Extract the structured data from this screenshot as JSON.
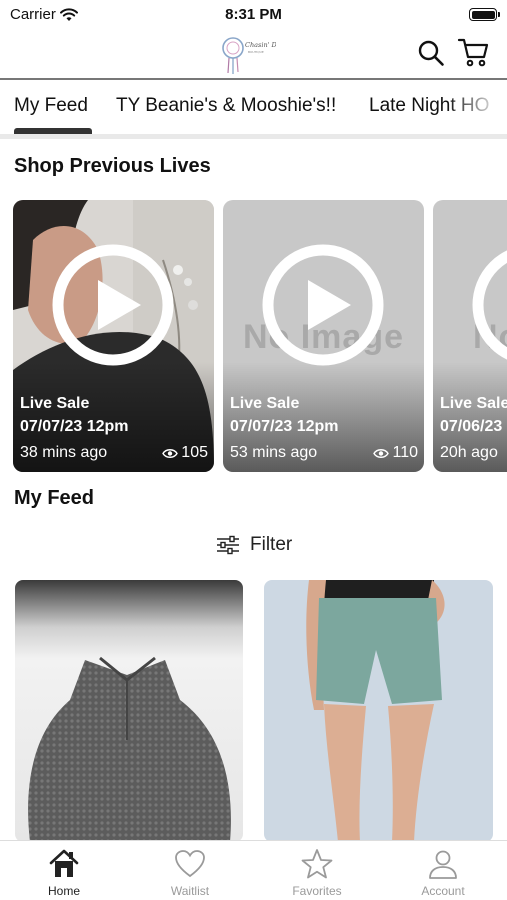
{
  "status_bar": {
    "carrier": "Carrier",
    "time": "8:31 PM"
  },
  "header": {
    "logo_text": "Chasin' Dreams",
    "logo_subtext": "BOUTIQUE"
  },
  "tabs": [
    {
      "label": "My Feed",
      "active": true
    },
    {
      "label": "TY Beanie's & Mooshie's!!",
      "active": false
    },
    {
      "label": "Late Night HO",
      "active": false
    }
  ],
  "previous_lives": {
    "title": "Shop Previous Lives",
    "cards": [
      {
        "title": "Live Sale",
        "date": "07/07/23 12pm",
        "ago": "38 mins ago",
        "views": "105",
        "image": "photo"
      },
      {
        "title": "Live Sale",
        "date": "07/07/23 12pm",
        "ago": "53 mins ago",
        "views": "110",
        "image": "No Image"
      },
      {
        "title": "Live Sale",
        "date": "07/06/23",
        "ago": "20h ago",
        "views": "",
        "image": "No Image"
      }
    ]
  },
  "feed": {
    "title": "My Feed",
    "filter_label": "Filter"
  },
  "bottom_nav": [
    {
      "label": "Home",
      "icon": "home-icon",
      "active": true
    },
    {
      "label": "Waitlist",
      "icon": "heart-icon",
      "active": false
    },
    {
      "label": "Favorites",
      "icon": "star-icon",
      "active": false
    },
    {
      "label": "Account",
      "icon": "person-icon",
      "active": false
    }
  ],
  "colors": {
    "accent": "#333333",
    "inactive_nav": "#9a9a9a",
    "card_placeholder": "#c8c8c8"
  }
}
